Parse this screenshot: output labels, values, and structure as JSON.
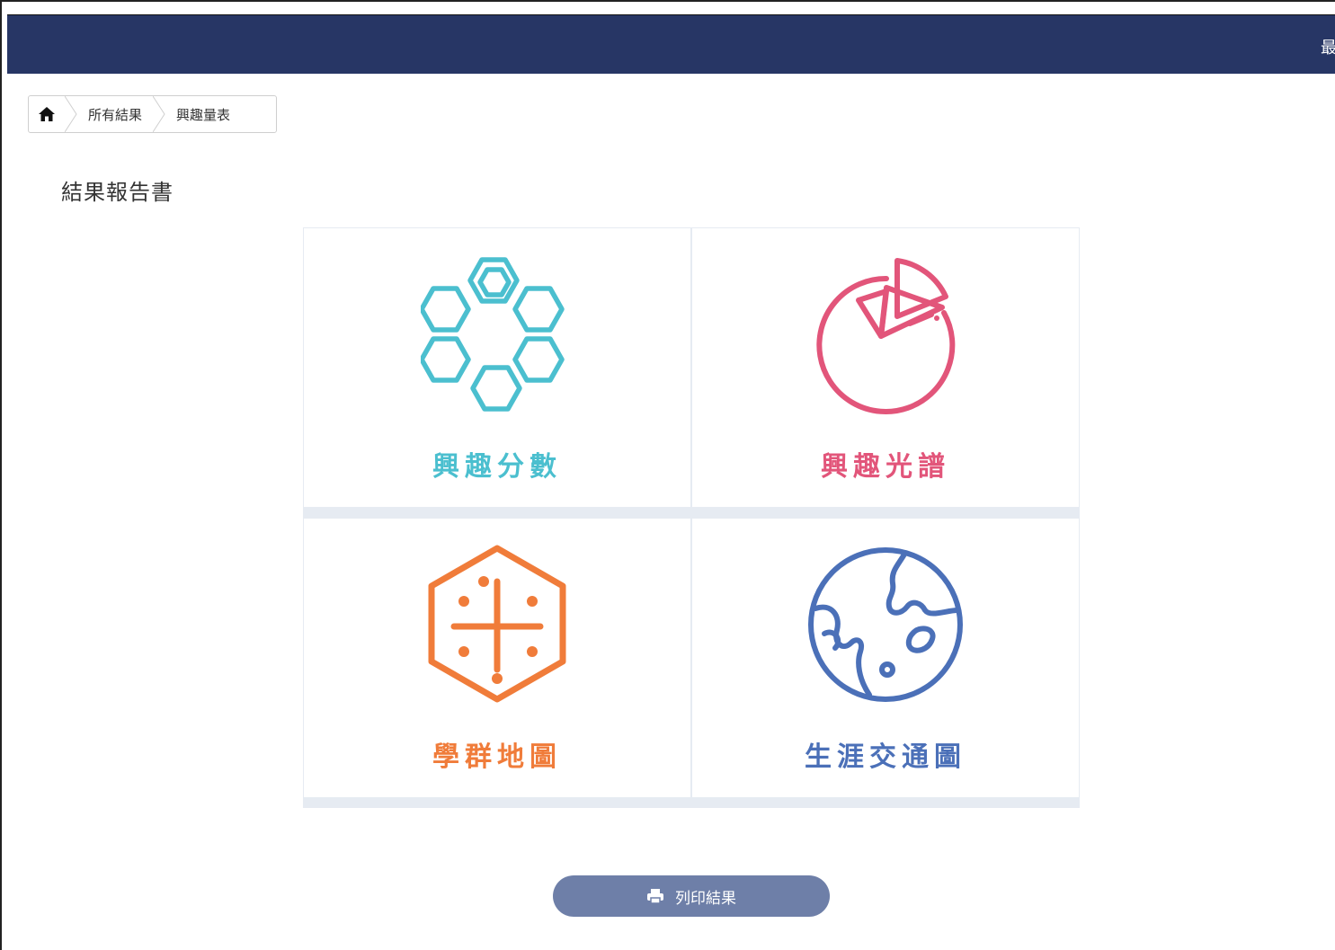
{
  "topbar": {
    "right_text_partial": "最"
  },
  "breadcrumb": {
    "home_icon": "home-icon",
    "items": [
      "所有結果",
      "興趣量表"
    ]
  },
  "page": {
    "title": "結果報告書"
  },
  "cards": [
    {
      "label": "興趣分數",
      "color": "#4bbfcf",
      "icon": "hexagon-cluster-icon"
    },
    {
      "label": "興趣光譜",
      "color": "#e2557a",
      "icon": "pie-chart-icon"
    },
    {
      "label": "學群地圖",
      "color": "#f07c3a",
      "icon": "hexagon-grid-icon"
    },
    {
      "label": "生涯交通圖",
      "color": "#4b70b8",
      "icon": "globe-icon"
    }
  ],
  "print_button": {
    "label": "列印結果",
    "icon": "printer-icon"
  }
}
